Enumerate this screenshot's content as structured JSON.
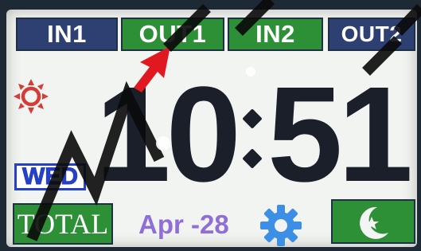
{
  "colors": {
    "tab_blue": "#2e3f72",
    "tab_green": "#2d8f36",
    "sun": "#d63b35",
    "gear": "#3d8fe6",
    "clock": "#1b1f2a",
    "date": "#8f6ed8",
    "wed_border": "#2540c4",
    "cursor": "#e01820"
  },
  "tabs": [
    {
      "label": "IN1",
      "color": "#2e3f72"
    },
    {
      "label": "OUT1",
      "color": "#2d8f36"
    },
    {
      "label": "IN2",
      "color": "#2d8f36"
    },
    {
      "label": "OUT2",
      "color": "#2e3f72"
    }
  ],
  "clock": {
    "hours": "10",
    "minutes": "51"
  },
  "day": "WED",
  "total_label": "TOTAL",
  "date": "Apr -28",
  "icons": {
    "sun": "sun-icon",
    "gear": "gear-icon",
    "night": "moon-star-icon",
    "cursor": "arrow-cursor-icon"
  }
}
